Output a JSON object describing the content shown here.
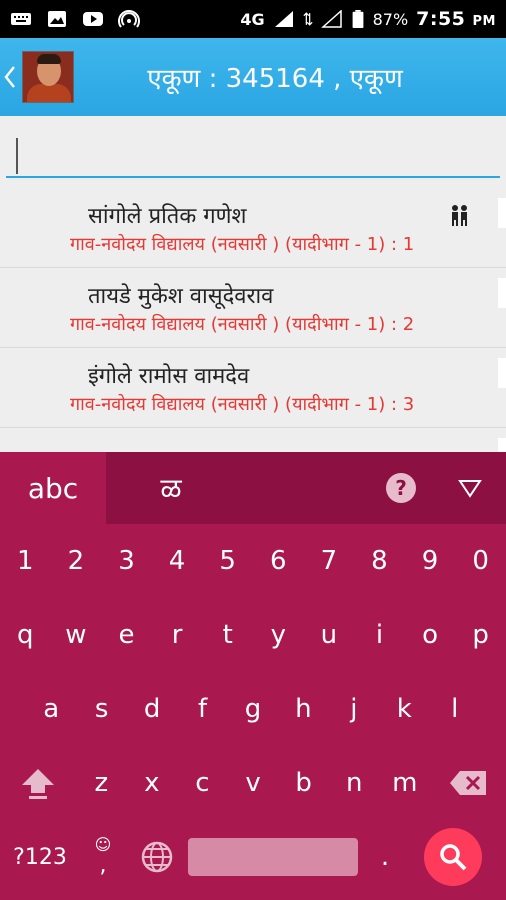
{
  "status_bar": {
    "network": "4G",
    "battery": "87%",
    "time": "7:55",
    "ampm": "PM"
  },
  "app_bar": {
    "title": "एकूण : 345164 , एकूण"
  },
  "search": {
    "value": ""
  },
  "list_items": [
    {
      "name": "सांगोले प्रतिक गणेश",
      "detail": "गाव-नवोदय विद्यालय (नवसारी ) (यादीभाग - 1) : 1"
    },
    {
      "name": "तायडे मुकेश वासूदेवराव",
      "detail": "गाव-नवोदय विद्यालय (नवसारी ) (यादीभाग - 1) : 2"
    },
    {
      "name": "इंगोले रामोस वामदेव",
      "detail": "गाव-नवोदय विद्यालय (नवसारी ) (यादीभाग - 1) : 3"
    }
  ],
  "keyboard": {
    "tab_abc": "abc",
    "tab_marathi": "ळ",
    "help": "?",
    "digits": [
      "1",
      "2",
      "3",
      "4",
      "5",
      "6",
      "7",
      "8",
      "9",
      "0"
    ],
    "row_q": [
      "q",
      "w",
      "e",
      "r",
      "t",
      "y",
      "u",
      "i",
      "o",
      "p"
    ],
    "row_a": [
      "a",
      "s",
      "d",
      "f",
      "g",
      "h",
      "j",
      "k",
      "l"
    ],
    "row_z": [
      "z",
      "x",
      "c",
      "v",
      "b",
      "n",
      "m"
    ],
    "symbols": "?123",
    "comma": ",",
    "period": ".",
    "icons": {
      "emoji": "emoji-icon",
      "globe": "globe-icon",
      "shift": "shift-icon",
      "backspace": "backspace-icon",
      "search": "search-icon"
    },
    "colors": {
      "background": "#a9184f",
      "accent": "#ff3b5c"
    }
  }
}
